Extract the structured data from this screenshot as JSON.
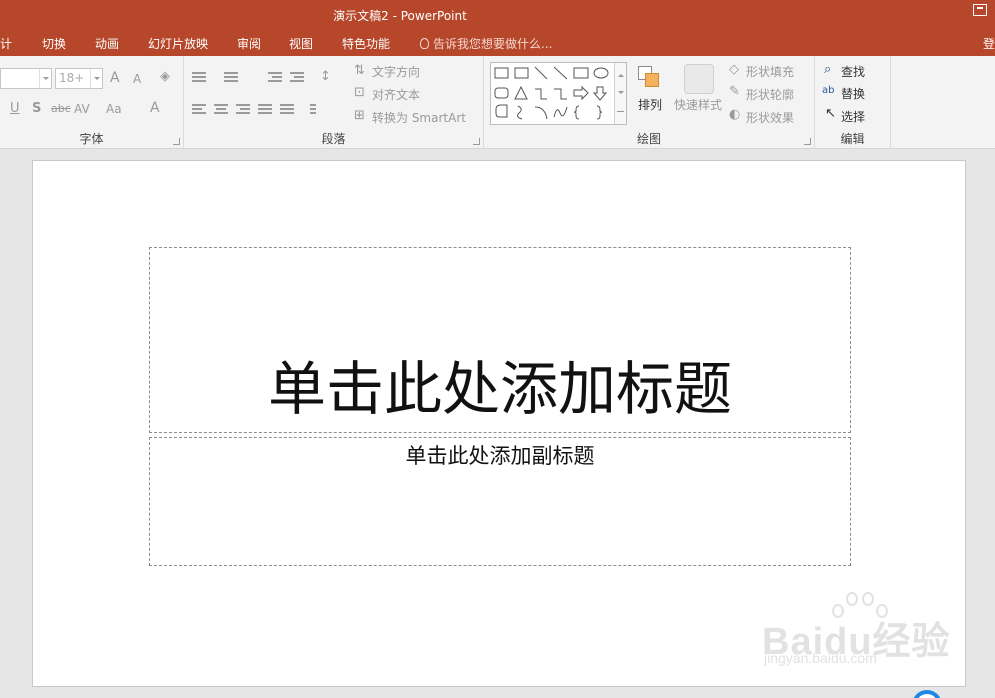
{
  "window": {
    "title": "演示文稿2 - PowerPoint"
  },
  "tabs": [
    {
      "label": "计"
    },
    {
      "label": "切换"
    },
    {
      "label": "动画"
    },
    {
      "label": "幻灯片放映"
    },
    {
      "label": "审阅"
    },
    {
      "label": "视图"
    },
    {
      "label": "特色功能"
    }
  ],
  "tell_me": "告诉我您想要做什么...",
  "login_label": "登",
  "font_group": {
    "label": "字体",
    "font_name": "",
    "font_size": "18+",
    "grow_label": "A",
    "shrink_label": "A",
    "underline": "U",
    "shadow": "S",
    "strike": "abc",
    "spacing": "AV",
    "case": "Aa",
    "color": "A"
  },
  "paragraph_group": {
    "label": "段落",
    "text_direction": "文字方向",
    "align_text": "对齐文本",
    "smartart": "转换为 SmartArt"
  },
  "drawing_group": {
    "label": "绘图",
    "arrange": "排列",
    "quick_styles": "快速样式",
    "shape_fill": "形状填充",
    "shape_outline": "形状轮廓",
    "shape_effects": "形状效果"
  },
  "editing_group": {
    "label": "编辑",
    "find": "查找",
    "replace": "替换",
    "select": "选择"
  },
  "slide": {
    "title_placeholder": "单击此处添加标题",
    "subtitle_placeholder": "单击此处添加副标题"
  },
  "watermark": {
    "brand": "Baidu经验",
    "url": "jingyan.baidu.com"
  },
  "colors": {
    "accent": "#b7472a",
    "ribbon_bg": "#f3f3f3",
    "canvas_bg": "#e6e6e6"
  }
}
